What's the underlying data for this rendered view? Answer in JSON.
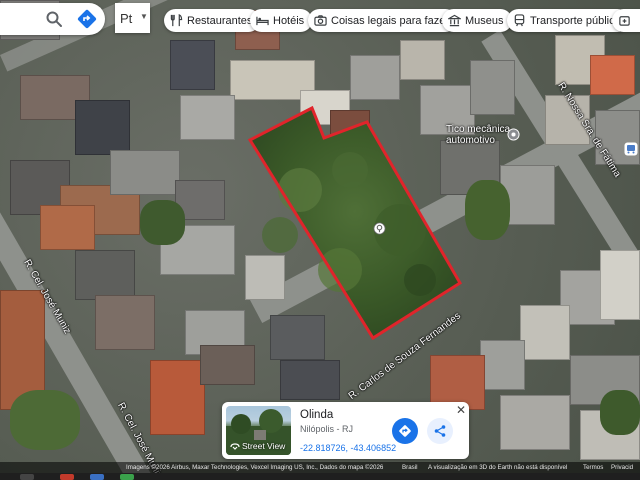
{
  "search": {
    "lang_value": "Pt"
  },
  "chips": [
    {
      "label": "Restaurantes",
      "icon": "fork-knife-icon"
    },
    {
      "label": "Hotéis",
      "icon": "bed-icon"
    },
    {
      "label": "Coisas legais para fazer",
      "icon": "camera-icon"
    },
    {
      "label": "Museus",
      "icon": "museum-icon"
    },
    {
      "label": "Transporte público",
      "icon": "train-icon"
    }
  ],
  "streets": {
    "nossa_senhora": "R. Nossa Sra. de Fátima",
    "jose_muniz_left": "R. Cel. José Muniz",
    "jose_muniz_bottom": "R. Cel. José Muniz",
    "carlos": "R. Carlos de Souza Fernandes"
  },
  "poi": {
    "name_line1": "Tico mecânica",
    "name_line2": "automotivo"
  },
  "card": {
    "title": "Olinda",
    "subtitle": "Nilópolis - RJ",
    "coords": "-22.818726, -43.406852",
    "street_view_label": "Street View",
    "close": "✕"
  },
  "footer": {
    "imagery": "Imagens ©2026 Airbus, Maxar Technologies, Vexcel Imaging US, Inc., Dados do mapa ©2026",
    "brasil": "Brasil",
    "earth_note": "A visualização em 3D do Earth não está disponível",
    "terms": "Termos",
    "privacy": "Privacid"
  },
  "colors": {
    "parcel_outline": "#e0242b",
    "accent": "#1a73e8"
  }
}
